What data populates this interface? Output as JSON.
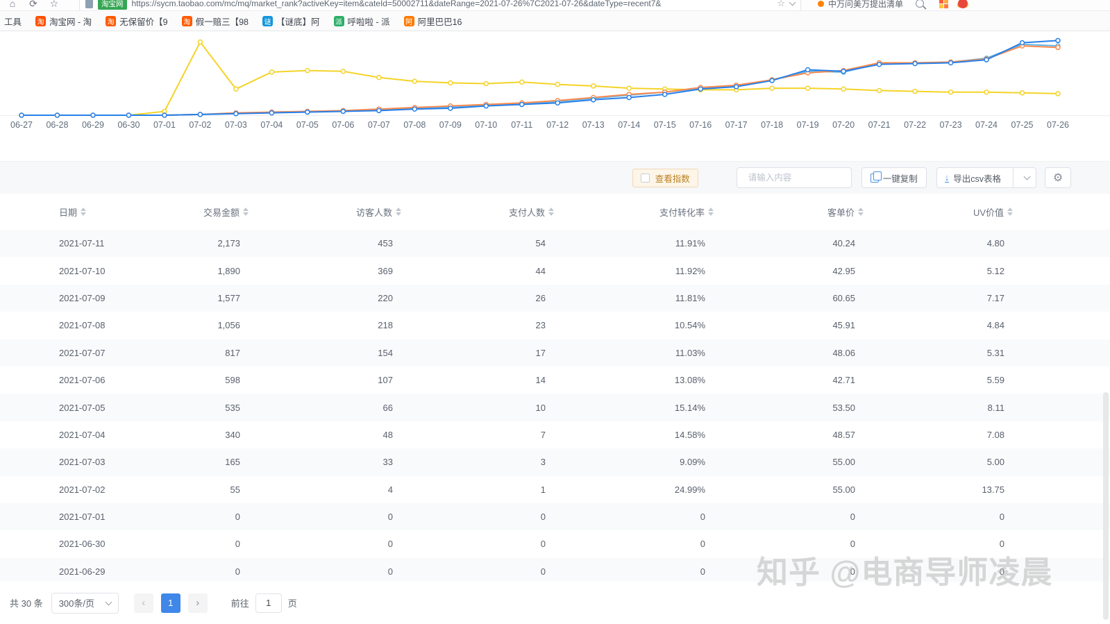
{
  "browser": {
    "nav_icons": [
      {
        "name": "home-icon",
        "glyph": "⌂"
      },
      {
        "name": "refresh-icon",
        "glyph": "⟳"
      },
      {
        "name": "favorite-star-icon",
        "glyph": "☆"
      }
    ],
    "site_badge": "淘宝网",
    "url": "https://sycm.taobao.com/mc/mq/market_rank?activeKey=item&cateId=50002711&dateRange=2021-07-26%7C2021-07-26&dateType=recent7&",
    "url_star": "☆",
    "quick_search_text": "中万问美万提出清单",
    "bookmarks": [
      {
        "label": "工具",
        "glyph": "",
        "color": ""
      },
      {
        "label": "淘宝网 - 淘",
        "glyph": "淘",
        "color": "#ff5000"
      },
      {
        "label": "无保留价【9",
        "glyph": "淘",
        "color": "#ff5a00"
      },
      {
        "label": "假一赔三【98",
        "glyph": "淘",
        "color": "#ff5a00"
      },
      {
        "label": "【谜底】阿",
        "glyph": "谜",
        "color": "#1296db"
      },
      {
        "label": "呼啦啦 - 派",
        "glyph": "派",
        "color": "#2bae67"
      },
      {
        "label": "阿里巴巴16",
        "glyph": "阿",
        "color": "#ff7a00"
      }
    ]
  },
  "chart_data": {
    "type": "line",
    "title": "",
    "xlabel": "",
    "ylabel": "",
    "ylim": [
      0,
      100
    ],
    "grid": false,
    "legend": "none",
    "x": [
      "06-27",
      "06-28",
      "06-29",
      "06-30",
      "07-01",
      "07-02",
      "07-03",
      "07-04",
      "07-05",
      "07-06",
      "07-07",
      "07-08",
      "07-09",
      "07-10",
      "07-11",
      "07-12",
      "07-13",
      "07-14",
      "07-15",
      "07-16",
      "07-17",
      "07-18",
      "07-19",
      "07-20",
      "07-21",
      "07-22",
      "07-23",
      "07-24",
      "07-25",
      "07-26"
    ],
    "series": [
      {
        "name": "yellow-series",
        "color": "#f5d327",
        "values": [
          0,
          0,
          0,
          0,
          5,
          95,
          34,
          56,
          58,
          57,
          49,
          44,
          42,
          41,
          43,
          40,
          38,
          35,
          34,
          33,
          33,
          35,
          35,
          34,
          32,
          31,
          30,
          30,
          29,
          28
        ]
      },
      {
        "name": "cyan-series",
        "color": "#62b5e5",
        "values": [
          0,
          0,
          0,
          0,
          0,
          1,
          2,
          4,
          5,
          6,
          7,
          9,
          11,
          13,
          15,
          18,
          22,
          26,
          30,
          35,
          38,
          46,
          57,
          56,
          67,
          68,
          69,
          74,
          92,
          90
        ]
      },
      {
        "name": "orange-series",
        "color": "#ff8a4d",
        "values": [
          0,
          0,
          0,
          0,
          0,
          1,
          3,
          4,
          5,
          6,
          8,
          10,
          12,
          14,
          16,
          19,
          23,
          27,
          30,
          36,
          39,
          46,
          55,
          58,
          68,
          68,
          69,
          73,
          90,
          88
        ]
      },
      {
        "name": "blue-series",
        "color": "#2680eb",
        "values": [
          0,
          0,
          0,
          0,
          0,
          1,
          2,
          3,
          4,
          5,
          6,
          8,
          9,
          12,
          14,
          16,
          20,
          23,
          27,
          34,
          37,
          45,
          59,
          57,
          66,
          67,
          68,
          72,
          94,
          97
        ]
      }
    ]
  },
  "toolbar": {
    "view_index_label": "查看指数",
    "search_placeholder": "请输入内容",
    "copy_label": "一键复制",
    "export_label": "导出csv表格"
  },
  "table": {
    "columns": [
      "日期",
      "交易金额",
      "访客人数",
      "支付人数",
      "支付转化率",
      "客单价",
      "UV价值"
    ],
    "rows": [
      [
        "2021-07-11",
        "2,173",
        "453",
        "54",
        "11.91%",
        "40.24",
        "4.80"
      ],
      [
        "2021-07-10",
        "1,890",
        "369",
        "44",
        "11.92%",
        "42.95",
        "5.12"
      ],
      [
        "2021-07-09",
        "1,577",
        "220",
        "26",
        "11.81%",
        "60.65",
        "7.17"
      ],
      [
        "2021-07-08",
        "1,056",
        "218",
        "23",
        "10.54%",
        "45.91",
        "4.84"
      ],
      [
        "2021-07-07",
        "817",
        "154",
        "17",
        "11.03%",
        "48.06",
        "5.31"
      ],
      [
        "2021-07-06",
        "598",
        "107",
        "14",
        "13.08%",
        "42.71",
        "5.59"
      ],
      [
        "2021-07-05",
        "535",
        "66",
        "10",
        "15.14%",
        "53.50",
        "8.11"
      ],
      [
        "2021-07-04",
        "340",
        "48",
        "7",
        "14.58%",
        "48.57",
        "7.08"
      ],
      [
        "2021-07-03",
        "165",
        "33",
        "3",
        "9.09%",
        "55.00",
        "5.00"
      ],
      [
        "2021-07-02",
        "55",
        "4",
        "1",
        "24.99%",
        "55.00",
        "13.75"
      ],
      [
        "2021-07-01",
        "0",
        "0",
        "0",
        "0",
        "0",
        "0"
      ],
      [
        "2021-06-30",
        "0",
        "0",
        "0",
        "0",
        "0",
        "0"
      ],
      [
        "2021-06-29",
        "0",
        "0",
        "0",
        "0",
        "0",
        "0"
      ]
    ]
  },
  "pagination": {
    "total_label": "共 30 条",
    "page_size": "300条/页",
    "current_page": "1",
    "goto_label": "前往",
    "goto_value": "1",
    "page_unit": "页"
  },
  "watermark": "知乎 @电商导师凌晨",
  "colors": {
    "accent_blue": "#3f87e8",
    "stripe": "#f9fafb",
    "axis_label": "#5f6c7b"
  }
}
